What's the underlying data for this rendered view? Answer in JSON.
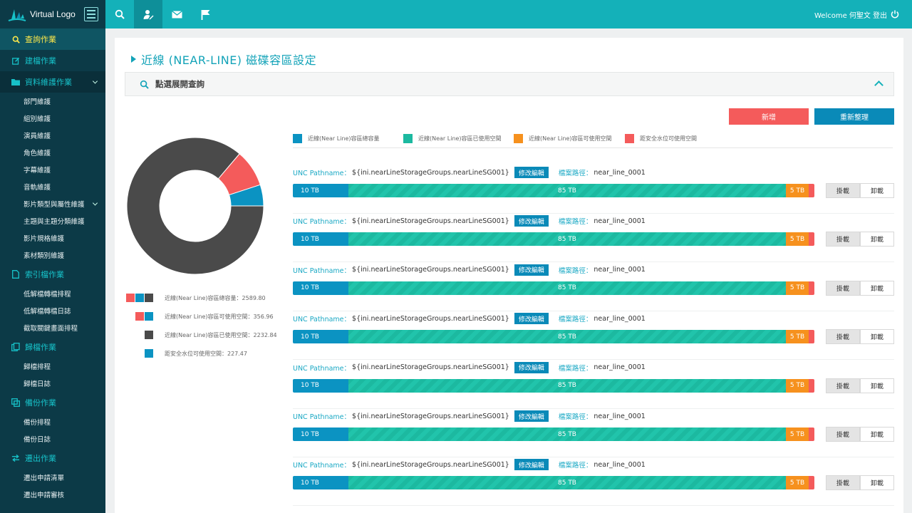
{
  "app": {
    "logo_text": "Virtual Logo"
  },
  "sidebar": {
    "items": [
      {
        "label": "查詢作業",
        "type": "section",
        "icon": "search-icon",
        "active": true
      },
      {
        "label": "建檔作業",
        "type": "section",
        "icon": "edit-icon"
      },
      {
        "label": "資料維護作業",
        "type": "section",
        "icon": "folder-icon",
        "expanded": true
      },
      {
        "label": "部門維護",
        "type": "sub"
      },
      {
        "label": "組別維護",
        "type": "sub"
      },
      {
        "label": "演員維護",
        "type": "sub"
      },
      {
        "label": "角色維護",
        "type": "sub"
      },
      {
        "label": "字幕維護",
        "type": "sub"
      },
      {
        "label": "音軌維護",
        "type": "sub"
      },
      {
        "label": "影片類型與屬性維護",
        "type": "sub",
        "expandable": true
      },
      {
        "label": "主題與主題分類維護",
        "type": "sub"
      },
      {
        "label": "影片規格維護",
        "type": "sub"
      },
      {
        "label": "素材類別維護",
        "type": "sub"
      },
      {
        "label": "索引檔作業",
        "type": "section",
        "icon": "document-icon"
      },
      {
        "label": "低解檔轉檔排程",
        "type": "sub"
      },
      {
        "label": "低解檔轉檔日誌",
        "type": "sub"
      },
      {
        "label": "截取關鍵畫面排程",
        "type": "sub"
      },
      {
        "label": "歸檔作業",
        "type": "section",
        "icon": "archive-icon"
      },
      {
        "label": "歸檔排程",
        "type": "sub"
      },
      {
        "label": "歸檔日誌",
        "type": "sub"
      },
      {
        "label": "備份作業",
        "type": "section",
        "icon": "copy-icon"
      },
      {
        "label": "備份排程",
        "type": "sub"
      },
      {
        "label": "備份日誌",
        "type": "sub"
      },
      {
        "label": "遷出作業",
        "type": "section",
        "icon": "transfer-icon"
      },
      {
        "label": "遷出申請清單",
        "type": "sub"
      },
      {
        "label": "遷出申請審核",
        "type": "sub"
      }
    ]
  },
  "topbar": {
    "buttons": [
      {
        "icon": "search-icon"
      },
      {
        "icon": "user-edit-icon"
      },
      {
        "icon": "mail-icon"
      },
      {
        "icon": "flag-icon"
      }
    ],
    "welcome": "Welcome 何聖文",
    "logout": "登出"
  },
  "page": {
    "title": "近線 (NEAR-LINE) 磁碟容區設定",
    "query_label": "點選展開查詢",
    "add_label": "新增",
    "reorg_label": "重新整理"
  },
  "legend": [
    {
      "label": "近線(Near Line)容區總容量",
      "color": "#0b93c2"
    },
    {
      "label": "近線(Near Line)容區已使用空間",
      "color": "#1cb9a0"
    },
    {
      "label": "近線(Near Line)容區可使用空間",
      "color": "#f6911e"
    },
    {
      "label": "距安全水位可使用空間",
      "color": "#f45b5b"
    }
  ],
  "pie": {
    "stats": [
      {
        "label": "近線(Near Line)容區總容量：2589.80",
        "swatches": [
          "#f45b5b",
          "#0b93c2",
          "#4a4a4a"
        ]
      },
      {
        "label": "近線(Near Line)容區可使用空間：356.96",
        "swatches": [
          "#f45b5b",
          "#0b93c2"
        ]
      },
      {
        "label": "近線(Near Line)容區已使用空間：2232.84",
        "swatches": [
          "#4a4a4a"
        ]
      },
      {
        "label": "距安全水位可使用空間：227.47",
        "swatches": [
          "#0b93c2"
        ]
      }
    ],
    "slices": [
      {
        "name": "used",
        "value": 2232.84,
        "color": "#4a4a4a"
      },
      {
        "name": "safe",
        "value": 227.47,
        "color": "#f45b5b"
      },
      {
        "name": "free",
        "value": 129.49,
        "color": "#0b93c2"
      }
    ]
  },
  "rows": [
    {
      "unc_key": "UNC Pathname：",
      "unc_value": "${ini.nearLineStorageGroups.nearLineSG001}",
      "edit": "修改編輯",
      "path_key": "檔案路徑：",
      "path_value": "near_line_0001",
      "seg_total": "10 TB",
      "seg_used": "85 TB",
      "seg_free": "5 TB",
      "mount": "掛載",
      "unmount": "卸載"
    },
    {
      "unc_key": "UNC Pathname：",
      "unc_value": "${ini.nearLineStorageGroups.nearLineSG001}",
      "edit": "修改編輯",
      "path_key": "檔案路徑：",
      "path_value": "near_line_0001",
      "seg_total": "10 TB",
      "seg_used": "85 TB",
      "seg_free": "5 TB",
      "mount": "掛載",
      "unmount": "卸載"
    },
    {
      "unc_key": "UNC Pathname：",
      "unc_value": "${ini.nearLineStorageGroups.nearLineSG001}",
      "edit": "修改編輯",
      "path_key": "檔案路徑：",
      "path_value": "near_line_0001",
      "seg_total": "10 TB",
      "seg_used": "85 TB",
      "seg_free": "5 TB",
      "mount": "掛載",
      "unmount": "卸載"
    },
    {
      "unc_key": "UNC Pathname：",
      "unc_value": "${ini.nearLineStorageGroups.nearLineSG001}",
      "edit": "修改編輯",
      "path_key": "檔案路徑：",
      "path_value": "near_line_0001",
      "seg_total": "10 TB",
      "seg_used": "85 TB",
      "seg_free": "5 TB",
      "mount": "掛載",
      "unmount": "卸載"
    },
    {
      "unc_key": "UNC Pathname：",
      "unc_value": "${ini.nearLineStorageGroups.nearLineSG001}",
      "edit": "修改編輯",
      "path_key": "檔案路徑：",
      "path_value": "near_line_0001",
      "seg_total": "10 TB",
      "seg_used": "85 TB",
      "seg_free": "5 TB",
      "mount": "掛載",
      "unmount": "卸載"
    },
    {
      "unc_key": "UNC Pathname：",
      "unc_value": "${ini.nearLineStorageGroups.nearLineSG001}",
      "edit": "修改編輯",
      "path_key": "檔案路徑：",
      "path_value": "near_line_0001",
      "seg_total": "10 TB",
      "seg_used": "85 TB",
      "seg_free": "5 TB",
      "mount": "掛載",
      "unmount": "卸載"
    },
    {
      "unc_key": "UNC Pathname：",
      "unc_value": "${ini.nearLineStorageGroups.nearLineSG001}",
      "edit": "修改編輯",
      "path_key": "檔案路徑：",
      "path_value": "near_line_0001",
      "seg_total": "10 TB",
      "seg_used": "85 TB",
      "seg_free": "5 TB",
      "mount": "掛載",
      "unmount": "卸載"
    }
  ]
}
